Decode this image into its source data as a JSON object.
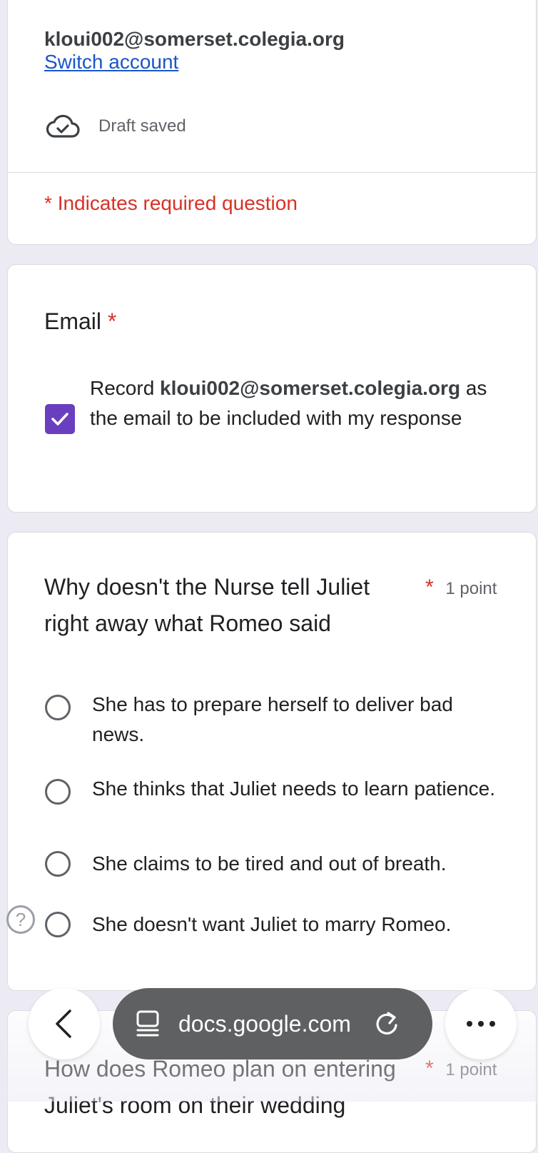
{
  "account": {
    "email": "kloui002@somerset.colegia.org",
    "switch_label": "Switch account",
    "draft_status": "Draft saved",
    "required_star": "*",
    "required_note": "Indicates required question"
  },
  "email_question": {
    "title": "Email",
    "required_star": "*",
    "record_prefix": "Record",
    "record_email": "kloui002@somerset.colegia.org",
    "record_suffix": "as the email to be included with my response",
    "checked": true
  },
  "question1": {
    "title": "Why doesn't the Nurse tell Juliet right away what Romeo said",
    "required_star": "*",
    "points": "1 point",
    "options": [
      "She has to prepare herself to deliver bad news.",
      "She thinks that Juliet needs to learn patience.",
      "She claims to be tired and out of breath.",
      "She doesn't want Juliet to marry Romeo."
    ]
  },
  "question2": {
    "title": "How does Romeo plan on entering Juliet's room on their wedding",
    "required_star": "*",
    "points": "1 point"
  },
  "browser": {
    "url": "docs.google.com",
    "help_glyph": "?"
  },
  "icons": {
    "draft": "cloud-check-icon",
    "back": "chevron-left-icon",
    "site": "tab-view-icon",
    "reload": "reload-icon",
    "more": "more-horizontal-icon",
    "help": "help-icon"
  },
  "colors": {
    "accent": "#6a3fbf",
    "required": "#d93025",
    "link": "#1a56c9",
    "background": "#ECEBF4"
  }
}
